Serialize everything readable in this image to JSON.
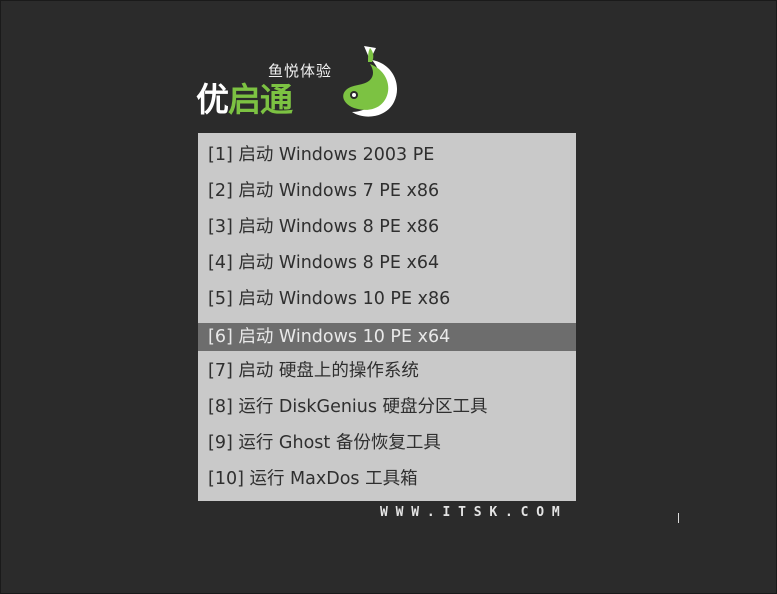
{
  "logo": {
    "tagline": "鱼悦体验",
    "name_part1": "优",
    "name_part2": "启通",
    "accent_color": "#7cc242"
  },
  "menu": {
    "items": [
      {
        "label": "[1] 启动 Windows 2003 PE",
        "selected": false
      },
      {
        "label": "[2] 启动 Windows 7 PE x86",
        "selected": false
      },
      {
        "label": "[3] 启动 Windows 8 PE x86",
        "selected": false
      },
      {
        "label": "[4] 启动 Windows 8 PE x64",
        "selected": false
      },
      {
        "label": "[5] 启动 Windows 10 PE x86",
        "selected": false
      },
      {
        "label": "[6] 启动 Windows 10 PE x64",
        "selected": true
      },
      {
        "label": "[7] 启动 硬盘上的操作系统",
        "selected": false
      },
      {
        "label": "[8] 运行 DiskGenius 硬盘分区工具",
        "selected": false
      },
      {
        "label": "[9] 运行 Ghost 备份恢复工具",
        "selected": false
      },
      {
        "label": "[10] 运行 MaxDos 工具箱",
        "selected": false
      }
    ]
  },
  "footer": {
    "url": "WWW.ITSK.COM"
  },
  "colors": {
    "background": "#2b2b2b",
    "menu_bg": "#c9c9c9",
    "menu_text": "#2f2f2f",
    "selected_bg": "#6d6d6d",
    "selected_text": "#e9e9e9"
  }
}
